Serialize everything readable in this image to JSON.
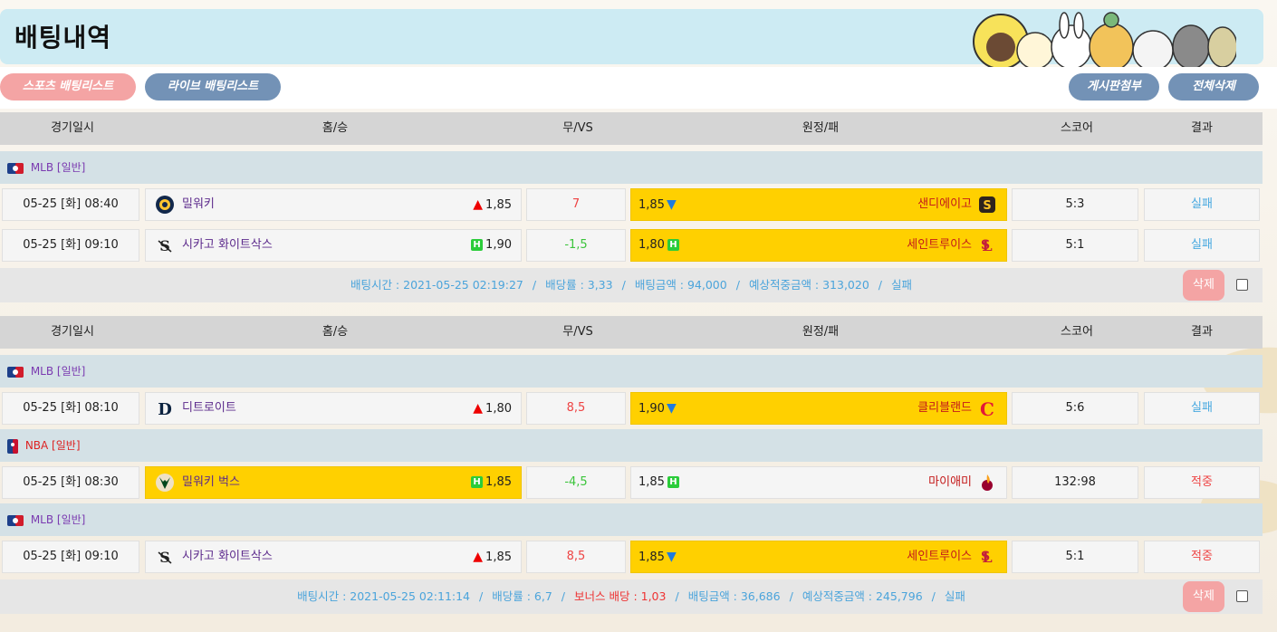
{
  "page": {
    "title": "배팅내역"
  },
  "toolbar": {
    "sports_list": "스포츠 배팅리스트",
    "live_list": "라이브 배팅리스트",
    "board_attach": "게시판첨부",
    "delete_all": "전체삭제"
  },
  "columns": [
    "경기일시",
    "홈/승",
    "무/VS",
    "원정/패",
    "스코어",
    "결과"
  ],
  "tickets": [
    {
      "groups": [
        {
          "league": "MLB [일반]",
          "rows": [
            {
              "date": "05-25 [화] 08:40",
              "home": "밀워키",
              "home_odds": "1,85",
              "home_mark": "up",
              "vs": "7",
              "away": "샌디에이고",
              "away_odds": "1,85",
              "away_mark": "down",
              "pick": "away",
              "score": "5:3",
              "result": "실패"
            },
            {
              "date": "05-25 [화] 09:10",
              "home": "시카고 화이트삭스",
              "home_odds": "1,90",
              "home_mark": "H",
              "vs": "-1,5",
              "away": "세인트루이스",
              "away_odds": "1,80",
              "away_mark": "H",
              "pick": "away",
              "score": "5:1",
              "result": "실패"
            }
          ]
        }
      ],
      "summary": {
        "bet_time": "배팅시간 : 2021-05-25 02:19:27",
        "rate": "배당률 : 3,33",
        "amount": "배팅금액 : 94,000",
        "expected": "예상적중금액 : 313,020",
        "status": "실패"
      },
      "delete_label": "삭제"
    },
    {
      "groups": [
        {
          "league": "MLB [일반]",
          "rows": [
            {
              "date": "05-25 [화] 08:10",
              "home": "디트로이트",
              "home_odds": "1,80",
              "home_mark": "up",
              "vs": "8,5",
              "away": "클리블랜드",
              "away_odds": "1,90",
              "away_mark": "down",
              "pick": "away",
              "score": "5:6",
              "result": "실패"
            }
          ]
        },
        {
          "league": "NBA [일반]",
          "rows": [
            {
              "date": "05-25 [화] 08:30",
              "home": "밀워키 벅스",
              "home_odds": "1,85",
              "home_mark": "H",
              "vs": "-4,5",
              "away": "마이애미",
              "away_odds": "1,85",
              "away_mark": "H",
              "pick": "home",
              "score": "132:98",
              "result": "적중"
            }
          ]
        },
        {
          "league": "MLB [일반]",
          "rows": [
            {
              "date": "05-25 [화] 09:10",
              "home": "시카고 화이트삭스",
              "home_odds": "1,85",
              "home_mark": "up",
              "vs": "8,5",
              "away": "세인트루이스",
              "away_odds": "1,85",
              "away_mark": "down",
              "pick": "away",
              "score": "5:1",
              "result": "적중"
            }
          ]
        }
      ],
      "summary": {
        "bet_time": "배팅시간 : 2021-05-25 02:11:14",
        "rate": "배당률 : 6,7",
        "bonus": "보너스 배당 : 1,03",
        "amount": "배팅금액 : 36,686",
        "expected": "예상적중금액 : 245,796",
        "status": "실패"
      },
      "delete_label": "삭제"
    }
  ],
  "colors": {
    "selected": "#ffd000",
    "header_bg": "#cdebf3",
    "fail": "#49a9e0",
    "win": "#e44444",
    "pink_button": "#f4a4a4",
    "blue_button": "#7392b6"
  }
}
